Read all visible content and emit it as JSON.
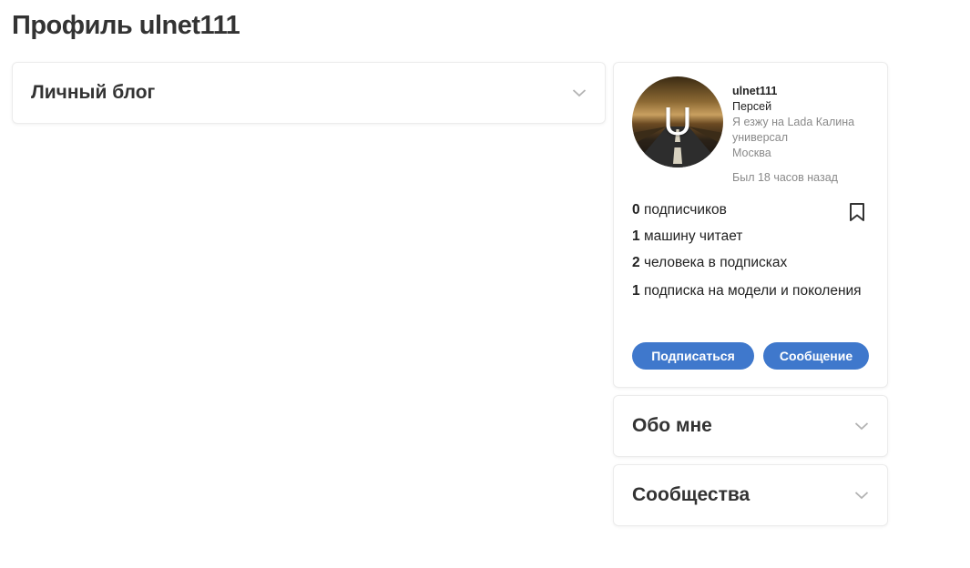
{
  "page": {
    "title": "Профиль ulnet111"
  },
  "blog": {
    "title": "Личный блог"
  },
  "profile": {
    "avatar_letter": "U",
    "username": "ulnet111",
    "car": "Персей",
    "drives": "Я езжу на Lada Калина универсал",
    "city": "Москва",
    "last_seen": "Был 18 часов назад",
    "stats": [
      {
        "count": "0",
        "label": "подписчиков"
      },
      {
        "count": "1",
        "label": "машину читает"
      },
      {
        "count": "2",
        "label": "человека в подписках"
      },
      {
        "count": "1",
        "label": "подписка на модели и поколения"
      }
    ],
    "subscribe_label": "Подписаться",
    "message_label": "Сообщение",
    "accent_color": "#3f78cc"
  },
  "about": {
    "title": "Обо мне"
  },
  "communities": {
    "title": "Сообщества"
  },
  "icons": {
    "chevron": "chevron-down-icon",
    "bookmark": "bookmark-icon"
  }
}
